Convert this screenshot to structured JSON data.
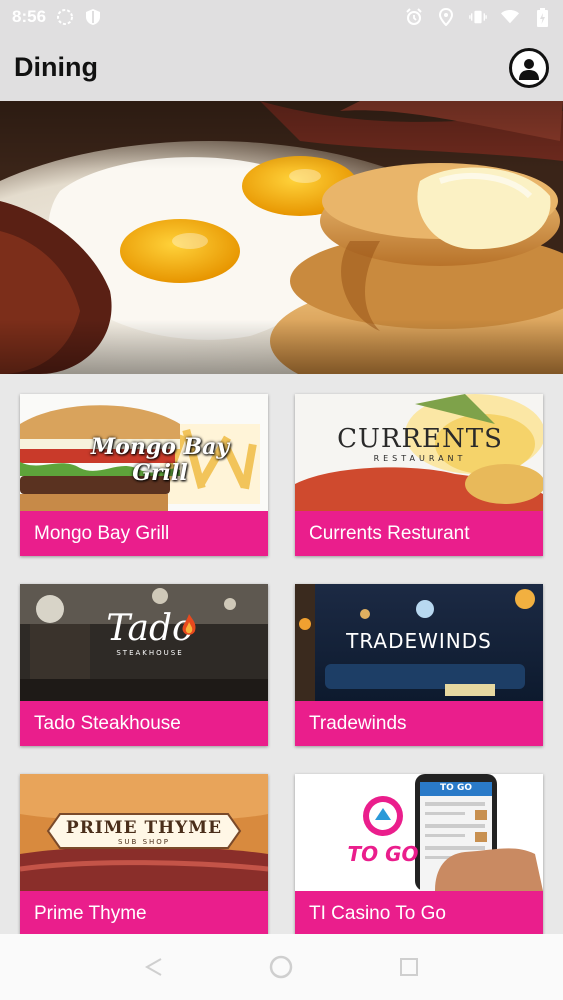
{
  "status_bar": {
    "time": "8:56",
    "icons": [
      "gesture-icon",
      "shield-icon",
      "alarm-icon",
      "location-icon",
      "vibrate-icon",
      "wifi-icon",
      "battery-icon"
    ]
  },
  "app_bar": {
    "title": "Dining",
    "account_icon": "account-circle-icon"
  },
  "hero": {
    "image": "breakfast plate with fried eggs, bacon and pancakes"
  },
  "restaurants": [
    {
      "label": "Mongo Bay Grill",
      "logo_text": "Mongo Bay Grill"
    },
    {
      "label": "Currents Resturant",
      "logo_text": "CURRENTS",
      "logo_sub": "RESTAURANT"
    },
    {
      "label": "Tado Steakhouse",
      "logo_text": "Tado",
      "logo_sub": "STEAKHOUSE"
    },
    {
      "label": "Tradewinds",
      "logo_text": "TRADEWINDS"
    },
    {
      "label": "Prime Thyme",
      "logo_text": "PRIME THYME",
      "logo_sub": "SUB SHOP"
    },
    {
      "label": "TI Casino To Go",
      "logo_text": "TO GO",
      "phone_text": "TO GO"
    }
  ],
  "colors": {
    "accent": "#ea1e8c",
    "background": "#e0dfe0"
  },
  "nav_bar": {
    "back_icon": "back-icon",
    "home_icon": "home-icon",
    "recents_icon": "recents-icon"
  }
}
